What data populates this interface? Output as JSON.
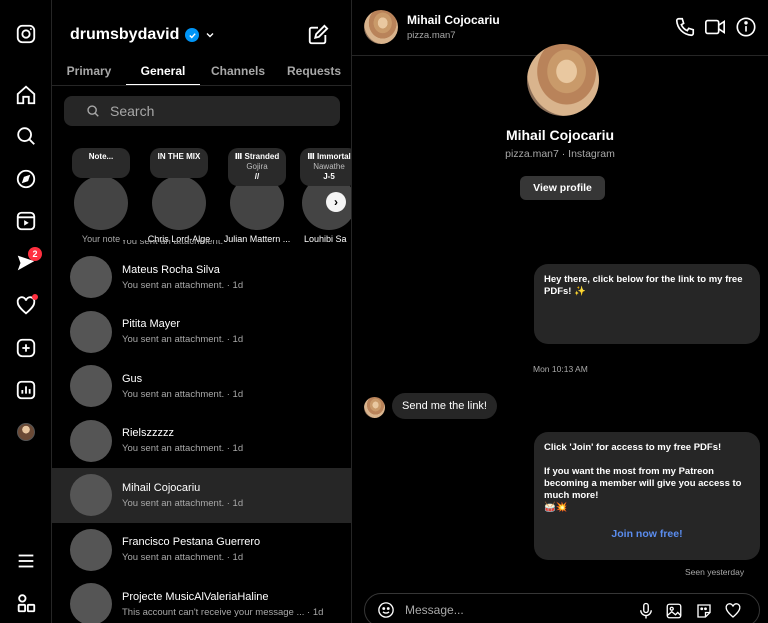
{
  "account": {
    "username": "drumsbydavid"
  },
  "tabs": [
    {
      "label": "Primary",
      "active": false
    },
    {
      "label": "General",
      "active": true
    },
    {
      "label": "Channels",
      "active": false
    },
    {
      "label": "Requests",
      "active": false
    }
  ],
  "search": {
    "placeholder": "Search"
  },
  "rail": {
    "notifications_badge": "2"
  },
  "notes": [
    {
      "bubble": "Note...",
      "sub": "",
      "sub2": "",
      "label": "Your note"
    },
    {
      "bubble": "IN THE MIX",
      "sub": "",
      "sub2": "",
      "label": "Chris Lord-Alge"
    },
    {
      "bubble": "Ⅲ Stranded",
      "sub": "Gojira",
      "sub2": "//",
      "label": "Julian Mattern ..."
    },
    {
      "bubble": "Ⅲ Immortal",
      "sub": "Nawathe",
      "sub2": "J-5",
      "label": "Louhibi Sa"
    }
  ],
  "partial_preview": "You sent an attachment.",
  "threads": [
    {
      "name": "Mateus Rocha Silva",
      "preview": "You sent an attachment. · 1d"
    },
    {
      "name": "Pitita Mayer",
      "preview": "You sent an attachment. · 1d"
    },
    {
      "name": "Gus",
      "preview": "You sent an attachment. · 1d"
    },
    {
      "name": "Rielszzzzz",
      "preview": "You sent an attachment. · 1d"
    },
    {
      "name": "Mihail Cojocariu",
      "preview": "You sent an attachment. · 1d"
    },
    {
      "name": "Francisco Pestana Guerrero",
      "preview": "You sent an attachment. · 1d"
    },
    {
      "name": "Projecte MusicAlValeriaHaline",
      "preview": "This account can't receive your message ... · 1d"
    }
  ],
  "chat": {
    "name": "Mihail Cojocariu",
    "username": "pizza.man7",
    "profile_meta": "pizza.man7 · Instagram",
    "view_profile": "View profile",
    "msg1": "Hey there, click below for the link to my free PDFs! ✨",
    "timestamp": "Mon 10:13 AM",
    "incoming": "Send me the link!",
    "msg2_line1": "Click 'Join' for access to my free PDFs!",
    "msg2_line2": "If you want the most from my Patreon becoming a member will give you access to much more!",
    "msg2_emoji": "🥁💥",
    "join_link": "Join now free!",
    "seen": "Seen yesterday",
    "composer_placeholder": "Message..."
  }
}
